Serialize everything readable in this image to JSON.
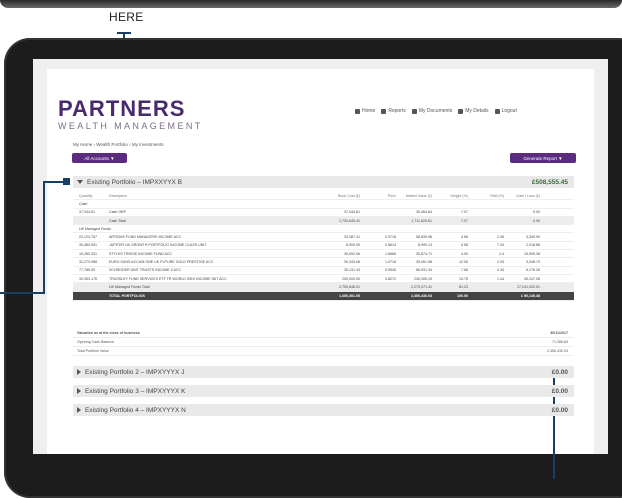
{
  "annotation": {
    "label": "HERE"
  },
  "colors": {
    "brand_purple": "#5a2b7e",
    "callout_blue": "#1a3f66",
    "device_frame": "#1c1c1c"
  },
  "logo": {
    "main": "PARTNERS",
    "sub": "WEALTH MANAGEMENT"
  },
  "topnav": {
    "items": [
      "Home",
      "Reports",
      "My Documents",
      "My Details",
      "Logout"
    ]
  },
  "breadcrumb": "My Home › Wealth Portfolio › My Investments",
  "buttons": {
    "all_accounts": "All Accounts ▼",
    "generate_report": "Generate Report ▼"
  },
  "portfolios": [
    {
      "name": "Existing Portfolio – IMPXXYYX B",
      "value": "£508,555.45"
    },
    {
      "name": "Existing Portfolio 2 – IMPXYYYX J",
      "value": "£0.00"
    },
    {
      "name": "Existing Portfolio 3 – IMPXYYYX K",
      "value": "£0.00"
    },
    {
      "name": "Existing Portfolio 4 – IMPXYYYX N",
      "value": "£0.00"
    }
  ],
  "table": {
    "headers": [
      "Quantity",
      "Description",
      "Book Cost (£)",
      "Price",
      "Market Value (£)",
      "Weight (%)",
      "Yield (%)",
      "Gain / Loss (£)"
    ],
    "cash_section": "Cash",
    "cash_rows": [
      [
        "37,044.61",
        "Cash GBP",
        "37,044.61",
        "",
        "35,464.64",
        "7.07",
        "",
        "0.00"
      ]
    ],
    "cash_total": [
      "",
      "Cash Total",
      "1,730,645.41",
      "",
      "1,711,629.61",
      "7.07",
      "",
      "0.00"
    ],
    "uk_section": "UK Managed Funds",
    "uk_rows": [
      [
        "23,123.767",
        "ARTEMIS FUND MANAGERS INCOME ACC",
        "33,387.41",
        "2.9716",
        "58,839.98",
        "4.66",
        "2.46",
        "3,349.90"
      ],
      [
        "35,483.951",
        "JUPITER UK GROWTH PORTFOLIO INCOME CLASS UNIT",
        "8,909.09",
        "0.6614",
        "8,999.13",
        "0.58",
        "7.43",
        "2,018.88"
      ],
      [
        "15,280.331",
        "STYLES TRIDGE INCOME FUND ACC",
        "35,592.06",
        "1.6669",
        "35,874.71",
        "4.00",
        "2.4",
        "10,505.38"
      ],
      [
        "32,273.958",
        "EURO SUNS ACCUM ONE UK FUTURE GOLD PRESTIGE ACC",
        "30,343.08",
        "1.0716",
        "35,061.58",
        "12.06",
        "2.05",
        "3,048.73"
      ],
      [
        "77,789.05",
        "SCHRODER UNIT TRUSTS INCOME Z ACC",
        "35,131.43",
        "0.5945",
        "66,931.34",
        "7.66",
        "4.34",
        "5,176.26"
      ],
      [
        "30,453.176",
        "TRUSSLEY FUND SERVICES ETF TR WORLD IDEX INCOME INIT ACC",
        "200,000.00",
        "3.8272",
        "240,306.19",
        "15.75",
        "1.44",
        "45,247.08"
      ]
    ],
    "uk_total": [
      "",
      "UK Managed Funds Total",
      "2,750,646.01",
      "",
      "2,279,071.41",
      "81.23",
      "",
      "17,241,020.01"
    ],
    "grand_total": [
      "",
      "TOTAL PORTFOLIOS",
      "1,650,301.05",
      "",
      "2,356,430.03",
      "100.00",
      "",
      "£ 90,145.38"
    ]
  },
  "summary": {
    "heading": "Valuation as at the close of business",
    "heading_value": "30/11/2017",
    "rows": [
      {
        "label": "Opening Cash Balance",
        "value": "71,366.63"
      },
      {
        "label": "Total Portfolio Value",
        "value": "2,356,430.03"
      }
    ]
  }
}
